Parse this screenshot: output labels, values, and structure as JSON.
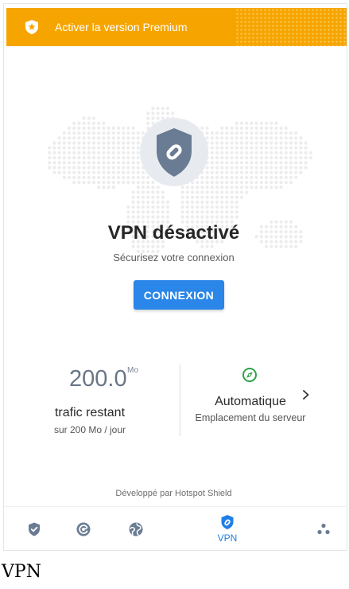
{
  "banner": {
    "label": "Activer la version Premium",
    "icon": "star-shield-icon",
    "color": "#f6a500"
  },
  "hero": {
    "title": "VPN désactivé",
    "subtitle": "Sécurisez votre connexion",
    "shield_icon": "shield-link-icon",
    "map": "world-dot-map"
  },
  "connect_button": {
    "label": "CONNEXION",
    "color": "#2a86e8"
  },
  "traffic": {
    "value": "200.0",
    "unit": "Mo",
    "label": "trafic restant",
    "sub": "sur 200 Mo / jour"
  },
  "server": {
    "icon": "compass-icon",
    "name": "Automatique",
    "sub": "Emplacement du serveur",
    "chevron": "chevron-right-icon",
    "accent": "#2ea24a"
  },
  "credit": "Développé par Hotspot Shield",
  "nav": {
    "items": [
      {
        "icon": "shield-check-icon",
        "label": ""
      },
      {
        "icon": "speed-gauge-icon",
        "label": ""
      },
      {
        "icon": "globe-icon",
        "label": ""
      },
      {
        "icon": "vpn-shield-icon",
        "label": "VPN",
        "active": true
      },
      {
        "icon": "more-dots-icon",
        "label": ""
      }
    ]
  },
  "page_caption": "VPN"
}
